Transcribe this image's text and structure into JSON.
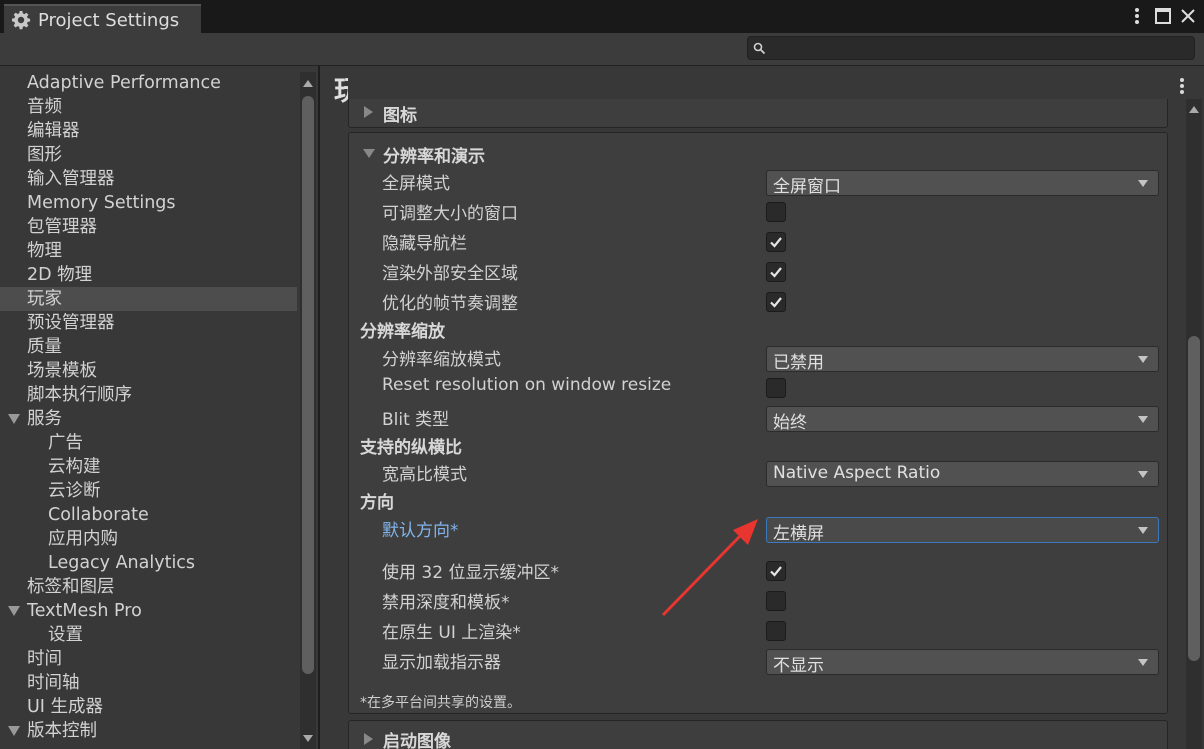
{
  "window": {
    "tab_title": "Project Settings",
    "search_placeholder": "",
    "search_value": ""
  },
  "sidebar": {
    "items": [
      {
        "label": "Adaptive Performance"
      },
      {
        "label": "音频"
      },
      {
        "label": "编辑器"
      },
      {
        "label": "图形"
      },
      {
        "label": "输入管理器"
      },
      {
        "label": "Memory Settings"
      },
      {
        "label": "包管理器"
      },
      {
        "label": "物理"
      },
      {
        "label": "2D 物理"
      },
      {
        "label": "玩家"
      },
      {
        "label": "预设管理器"
      },
      {
        "label": "质量"
      },
      {
        "label": "场景模板"
      },
      {
        "label": "脚本执行顺序"
      },
      {
        "label": "服务"
      },
      {
        "label": "广告"
      },
      {
        "label": "云构建"
      },
      {
        "label": "云诊断"
      },
      {
        "label": "Collaborate"
      },
      {
        "label": "应用内购"
      },
      {
        "label": "Legacy Analytics"
      },
      {
        "label": "标签和图层"
      },
      {
        "label": "TextMesh Pro"
      },
      {
        "label": "设置"
      },
      {
        "label": "时间"
      },
      {
        "label": "时间轴"
      },
      {
        "label": "UI 生成器"
      },
      {
        "label": "版本控制"
      }
    ],
    "selected": "玩家"
  },
  "main": {
    "title": "玩家",
    "icon_section": {
      "title": "图标"
    },
    "resolution": {
      "title": "分辨率和演示",
      "fullscreen_mode": {
        "label": "全屏模式",
        "value": "全屏窗口"
      },
      "resizable_window": {
        "label": "可调整大小的窗口",
        "checked": false
      },
      "hide_nav_bar": {
        "label": "隐藏导航栏",
        "checked": true
      },
      "render_outside_safe": {
        "label": "渲染外部安全区域",
        "checked": true
      },
      "optimized_frame_pacing": {
        "label": "优化的帧节奏调整",
        "checked": true
      },
      "scaling_group": "分辨率缩放",
      "scaling_mode": {
        "label": "分辨率缩放模式",
        "value": "已禁用"
      },
      "reset_on_resize": {
        "label": "Reset resolution on window resize",
        "checked": false
      },
      "blit_type": {
        "label": "Blit 类型",
        "value": "始终"
      },
      "aspect_group": "支持的纵横比",
      "aspect_mode": {
        "label": "宽高比模式",
        "value": "Native Aspect Ratio"
      },
      "orientation_group": "方向",
      "default_orientation": {
        "label": "默认方向*",
        "value": "左横屏"
      },
      "use_32bit": {
        "label": "使用 32 位显示缓冲区*",
        "checked": true
      },
      "disable_depth": {
        "label": "禁用深度和模板*",
        "checked": false
      },
      "render_native_ui": {
        "label": "在原生 UI 上渲染*",
        "checked": false
      },
      "loading_indicator": {
        "label": "显示加载指示器",
        "value": "不显示"
      },
      "footnote": "*在多平台间共享的设置。"
    },
    "splash_section": {
      "title": "启动图像"
    }
  },
  "colors": {
    "accent_modified": "#82b4ec",
    "annotation_arrow": "#e8352f"
  }
}
